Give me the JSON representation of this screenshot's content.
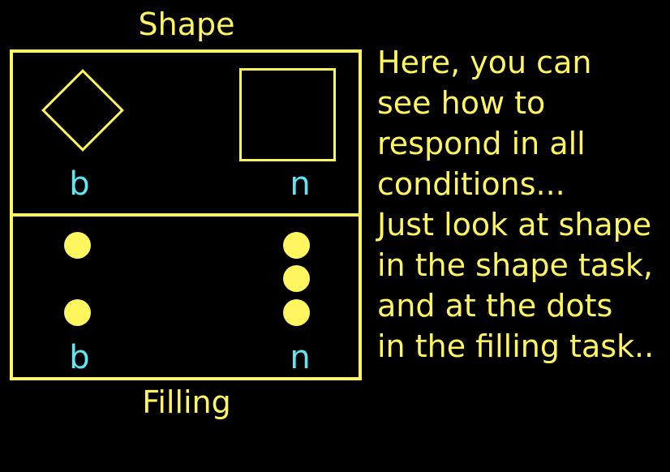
{
  "colors": {
    "background": "#000000",
    "accent": "#fff55f",
    "key": "#5ee6f2"
  },
  "labels": {
    "top": "Shape",
    "bottom": "Filling"
  },
  "shape_panel": {
    "left_icon": "diamond-icon",
    "right_icon": "square-icon",
    "left_key": "b",
    "right_key": "n"
  },
  "filling_panel": {
    "left_dot_count": 2,
    "right_dot_count": 3,
    "left_key": "b",
    "right_key": "n"
  },
  "instructions": [
    "Here, you can",
    "see how to",
    "respond in all",
    "conditions...",
    "Just look at shape",
    "in the shape task,",
    "and at the dots",
    "in the filling task.."
  ]
}
